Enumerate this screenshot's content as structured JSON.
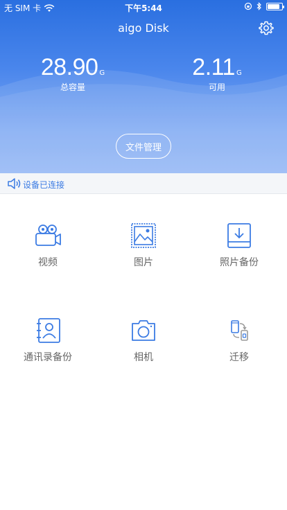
{
  "status_bar": {
    "carrier": "无 SIM 卡",
    "time": "下午5:44",
    "battery_level": 0.85
  },
  "header": {
    "title": "aigo Disk",
    "total": {
      "value": "28.90",
      "unit": "G",
      "label": "总容量"
    },
    "free": {
      "value": "2.11",
      "unit": "G",
      "label": "可用"
    },
    "file_button": "文件管理"
  },
  "connection": {
    "status": "设备已连接",
    "icon": "speaker-icon"
  },
  "grid": {
    "items": [
      {
        "label": "视频",
        "icon": "video-camera-icon"
      },
      {
        "label": "图片",
        "icon": "picture-icon"
      },
      {
        "label": "照片备份",
        "icon": "photo-backup-icon"
      },
      {
        "label": "通讯录备份",
        "icon": "contacts-backup-icon"
      },
      {
        "label": "相机",
        "icon": "camera-icon"
      },
      {
        "label": "迁移",
        "icon": "migrate-icon"
      }
    ]
  },
  "colors": {
    "header_top": "#2a6fe0",
    "header_bottom": "#8fb4f5",
    "icon_blue": "#3b7be3",
    "label_gray": "#666666"
  }
}
